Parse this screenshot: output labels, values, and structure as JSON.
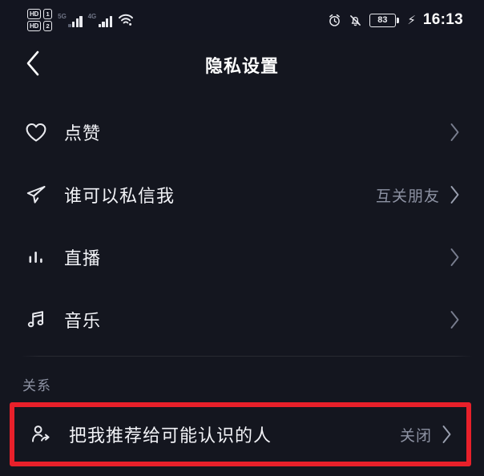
{
  "status_bar": {
    "hd_badge_1": "HD",
    "hd_badge_2": "HD",
    "sim_badge_1": "1",
    "sim_badge_2": "2",
    "network_1": "5G",
    "network_2": "4G",
    "wifi_icon": "wifi-icon",
    "alarm_icon": "alarm-clock-icon",
    "mute_icon": "bell-muted-icon",
    "battery_level": "83",
    "charging_icon": "lightning-bolt-icon",
    "time": "16:13"
  },
  "nav": {
    "back_icon": "chevron-left-icon",
    "title": "隐私设置"
  },
  "list": {
    "items": [
      {
        "icon": "heart-icon",
        "label": "点赞",
        "value": "",
        "chevron": "chevron-right-icon"
      },
      {
        "icon": "paper-plane-icon",
        "label": "谁可以私信我",
        "value": "互关朋友",
        "chevron": "chevron-right-icon"
      },
      {
        "icon": "live-bars-icon",
        "label": "直播",
        "value": "",
        "chevron": "chevron-right-icon"
      },
      {
        "icon": "music-note-icon",
        "label": "音乐",
        "value": "",
        "chevron": "chevron-right-icon"
      }
    ]
  },
  "section": {
    "title": "关系",
    "highlighted_row": {
      "icon": "person-share-icon",
      "label": "把我推荐给可能认识的人",
      "value": "关闭",
      "chevron": "chevron-right-icon"
    },
    "highlight_color": "#e8202a"
  }
}
